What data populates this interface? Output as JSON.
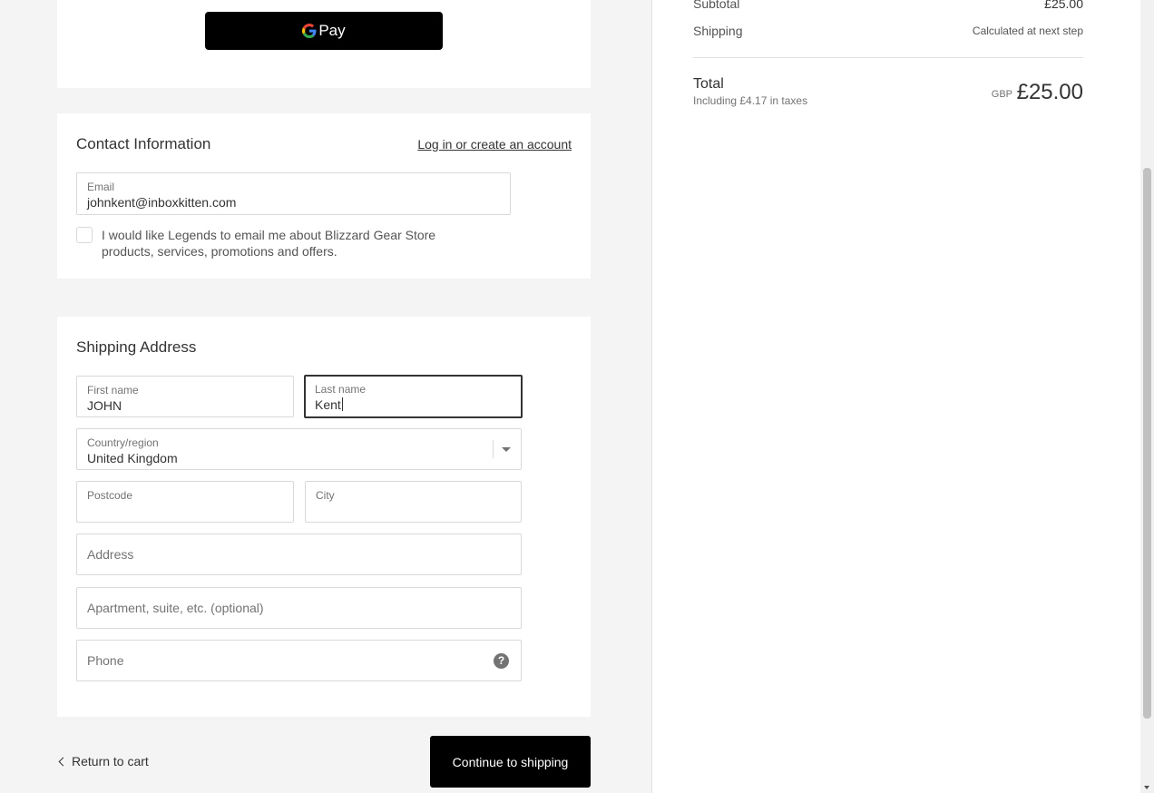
{
  "express_pay": {
    "g_letter": "G",
    "label": "Pay"
  },
  "contact": {
    "title": "Contact Information",
    "login_link": "Log in or create an account",
    "email": {
      "label": "Email",
      "value": "johnkent@inboxkitten.com"
    },
    "marketing_label": "I would like Legends to email me about Blizzard Gear Store products, services, promotions and offers."
  },
  "shipping": {
    "title": "Shipping Address",
    "first_name": {
      "label": "First name",
      "value": "JOHN"
    },
    "last_name": {
      "label": "Last name",
      "value": "Kent"
    },
    "country": {
      "label": "Country/region",
      "value": "United Kingdom"
    },
    "postcode": {
      "label": "Postcode",
      "value": ""
    },
    "city": {
      "label": "City",
      "value": ""
    },
    "address_placeholder": "Address",
    "apartment_placeholder": "Apartment, suite, etc. (optional)",
    "phone_placeholder": "Phone",
    "help_glyph": "?"
  },
  "actions": {
    "return_label": "Return to cart",
    "continue_label": "Continue to shipping"
  },
  "summary": {
    "subtotal_label": "Subtotal",
    "subtotal_value": "£25.00",
    "shipping_label": "Shipping",
    "shipping_value": "Calculated at next step",
    "total_label": "Total",
    "tax_note": "Including £4.17 in taxes",
    "currency": "GBP",
    "total_value": "£25.00"
  }
}
